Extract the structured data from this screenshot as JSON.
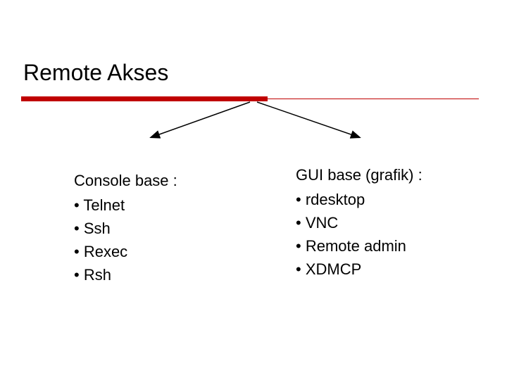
{
  "title": "Remote Akses",
  "left": {
    "heading": "Console base :",
    "items": [
      "Telnet",
      "Ssh",
      "Rexec",
      "Rsh"
    ]
  },
  "right": {
    "heading": "GUI base (grafik) :",
    "items": [
      "rdesktop",
      "VNC",
      "Remote admin",
      "XDMCP"
    ]
  }
}
